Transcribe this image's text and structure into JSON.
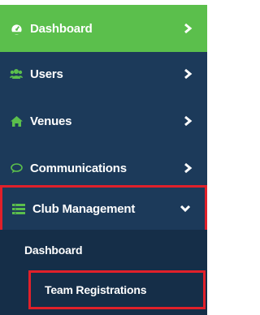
{
  "nav": {
    "items": [
      {
        "label": "Dashboard",
        "icon": "dashboard-icon"
      },
      {
        "label": "Users",
        "icon": "users-icon"
      },
      {
        "label": "Venues",
        "icon": "home-icon"
      },
      {
        "label": "Communications",
        "icon": "chat-icon"
      },
      {
        "label": "Club Management",
        "icon": "list-icon"
      }
    ],
    "submenu": [
      {
        "label": "Dashboard"
      },
      {
        "label": "Team Registrations"
      }
    ]
  },
  "colors": {
    "sidebar": "#1c3a5a",
    "active": "#5bbf4c",
    "submenu_bg": "#152e48",
    "highlight_border": "#e0202a",
    "icon_green": "#5bbf4c"
  }
}
